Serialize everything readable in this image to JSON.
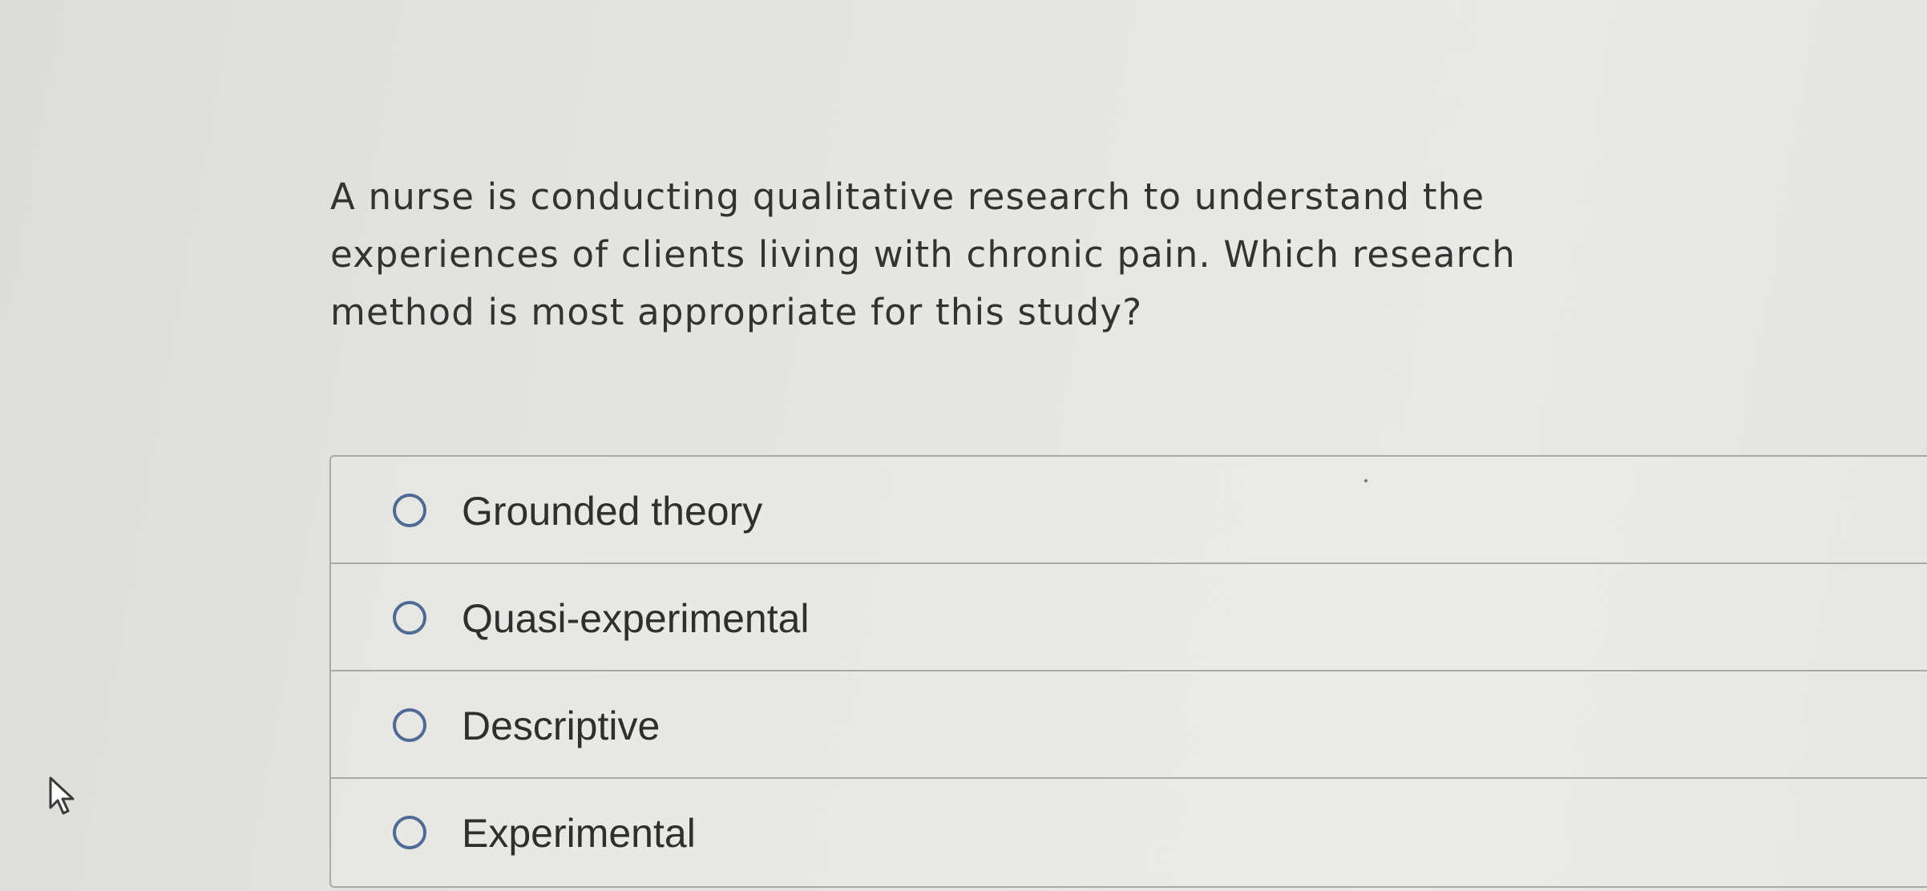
{
  "question": {
    "text": "A nurse is conducting qualitative research to understand the experiences of clients living with chronic pain. Which research method is most appropriate for this study?"
  },
  "options": [
    {
      "label": "Grounded theory",
      "selected": false
    },
    {
      "label": "Quasi-experimental",
      "selected": false
    },
    {
      "label": "Descriptive",
      "selected": false
    },
    {
      "label": "Experimental",
      "selected": false
    }
  ],
  "icons": {
    "cursor": "mouse-pointer-icon",
    "radio": "radio-button-unselected-icon"
  },
  "colors": {
    "radio_border": "#4f6b95",
    "text": "#333333",
    "divider": "#a9a9a6"
  }
}
